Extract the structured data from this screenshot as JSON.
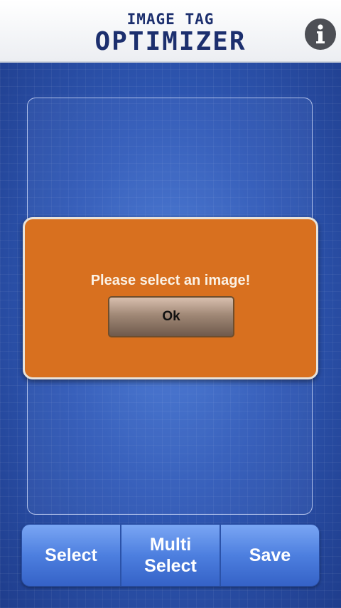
{
  "header": {
    "title_top": "IMAGE TAG",
    "title_main": "OPTIMIZER",
    "info_icon": "info-icon"
  },
  "dialog": {
    "message": "Please select an image!",
    "ok_label": "Ok"
  },
  "toolbar": {
    "select_label": "Select",
    "multi_select_line1": "Multi",
    "multi_select_line2": "Select",
    "save_label": "Save"
  },
  "colors": {
    "header_text": "#1c2f6e",
    "background_blue": "#2f58b4",
    "dialog_orange": "#d8701f",
    "toolbar_blue": "#4d7fdf"
  }
}
